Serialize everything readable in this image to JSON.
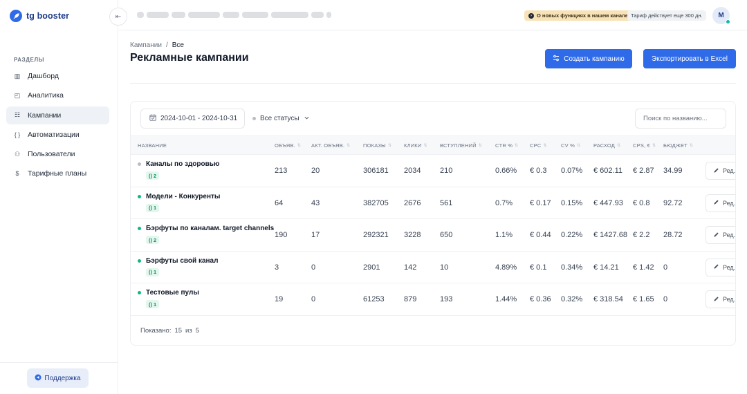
{
  "app": {
    "logo_text": "tg booster",
    "collapse_icon": "⇤"
  },
  "sidebar": {
    "section_label": "РАЗДЕЛЫ",
    "items": [
      {
        "label": "Дашборд",
        "icon": "chart-bars-icon",
        "glyph": "▥",
        "active": false
      },
      {
        "label": "Аналитика",
        "icon": "analytics-icon",
        "glyph": "◰",
        "active": false
      },
      {
        "label": "Кампании",
        "icon": "campaigns-icon",
        "glyph": "☷",
        "active": true
      },
      {
        "label": "Автоматизации",
        "icon": "braces-icon",
        "glyph": "{ }",
        "active": false
      },
      {
        "label": "Пользователи",
        "icon": "users-icon",
        "glyph": "⚇",
        "active": false
      },
      {
        "label": "Тарифные планы",
        "icon": "dollar-icon",
        "glyph": "$",
        "active": false
      }
    ],
    "support_label": "Поддержка"
  },
  "header": {
    "notice": "О новых функциях в нашем канале",
    "tariff": "Тариф действует еще 300 дн.",
    "avatar_initial": "M"
  },
  "breadcrumb": {
    "root": "Кампании",
    "separator": "/",
    "current": "Все"
  },
  "page": {
    "title": "Рекламные кампании",
    "create_button": "Создать кампанию",
    "export_button": "Экспортировать в Excel"
  },
  "filters": {
    "date_range": "2024-10-01 - 2024-10-31",
    "status": "Все статусы",
    "search_placeholder": "Поиск по названию..."
  },
  "table": {
    "columns": [
      "НАЗВАНИЕ",
      "ОБЪЯВ.",
      "АКТ. ОБЪЯВ.",
      "ПОКАЗЫ",
      "КЛИКИ",
      "ВСТУПЛЕНИЙ",
      "CTR %",
      "CPC",
      "CV %",
      "РАСХОД",
      "CPS, €",
      "БЮДЖЕТ"
    ],
    "edit_label": "Ред.",
    "rows": [
      {
        "name": "Каналы по здоровью",
        "status_color": "#b8bcc4",
        "chip": "2",
        "ads": "213",
        "active_ads": "20",
        "impressions": "306181",
        "clicks": "2034",
        "joins": "210",
        "ctr": "0.66%",
        "cpc": "€ 0.3",
        "cv": "0.07%",
        "spend": "€ 602.11",
        "cps": "€ 2.87",
        "budget": "34.99"
      },
      {
        "name": "Модели - Конкуренты",
        "status_color": "#10b981",
        "chip": "1",
        "ads": "64",
        "active_ads": "43",
        "impressions": "382705",
        "clicks": "2676",
        "joins": "561",
        "ctr": "0.7%",
        "cpc": "€ 0.17",
        "cv": "0.15%",
        "spend": "€ 447.93",
        "cps": "€ 0.8",
        "budget": "92.72"
      },
      {
        "name": "Бэрфуты по каналам. target channels",
        "status_color": "#10b981",
        "chip": "2",
        "ads": "190",
        "active_ads": "17",
        "impressions": "292321",
        "clicks": "3228",
        "joins": "650",
        "ctr": "1.1%",
        "cpc": "€ 0.44",
        "cv": "0.22%",
        "spend": "€ 1427.68",
        "cps": "€ 2.2",
        "budget": "28.72"
      },
      {
        "name": "Бэрфуты свой канал",
        "status_color": "#10b981",
        "chip": "1",
        "ads": "3",
        "active_ads": "0",
        "impressions": "2901",
        "clicks": "142",
        "joins": "10",
        "ctr": "4.89%",
        "cpc": "€ 0.1",
        "cv": "0.34%",
        "spend": "€ 14.21",
        "cps": "€ 1.42",
        "budget": "0"
      },
      {
        "name": "Тестовые пулы",
        "status_color": "#10b981",
        "chip": "1",
        "ads": "19",
        "active_ads": "0",
        "impressions": "61253",
        "clicks": "879",
        "joins": "193",
        "ctr": "1.44%",
        "cpc": "€ 0.36",
        "cv": "0.32%",
        "spend": "€ 318.54",
        "cps": "€ 1.65",
        "budget": "0"
      }
    ]
  },
  "pagination": {
    "shown_label": "Показано:",
    "shown": "15",
    "of_label": "из",
    "total": "5"
  },
  "colors": {
    "accent": "#2f6be8",
    "active_status": "#10b981",
    "inactive_status": "#b8bcc4",
    "notice_bg": "#f8e3b8"
  }
}
